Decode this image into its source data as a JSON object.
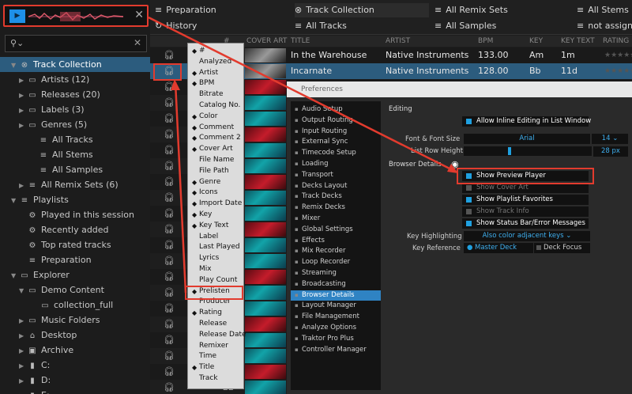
{
  "left": {
    "preview_player": {
      "play_label": "▶",
      "close_label": "✕"
    },
    "search": {
      "placeholder": "",
      "clear_label": "✕"
    },
    "tree": [
      {
        "label": "Track Collection",
        "icon": "collection-icon"
      },
      {
        "label": "Artists (12)",
        "icon": "folder-icon"
      },
      {
        "label": "Releases (20)",
        "icon": "folder-icon"
      },
      {
        "label": "Labels (3)",
        "icon": "folder-icon"
      },
      {
        "label": "Genres (5)",
        "icon": "folder-icon"
      },
      {
        "label": "All Tracks",
        "icon": "list-icon"
      },
      {
        "label": "All Stems",
        "icon": "list-icon"
      },
      {
        "label": "All Samples",
        "icon": "list-icon"
      },
      {
        "label": "All Remix Sets (6)",
        "icon": "list-icon"
      },
      {
        "label": "Playlists",
        "icon": "playlists-icon"
      },
      {
        "label": "Played in this session",
        "icon": "gear-icon"
      },
      {
        "label": "Recently added",
        "icon": "gear-icon"
      },
      {
        "label": "Top rated tracks",
        "icon": "gear-icon"
      },
      {
        "label": "Preparation",
        "icon": "list-icon"
      },
      {
        "label": "Explorer",
        "icon": "monitor-icon"
      },
      {
        "label": "Demo Content",
        "icon": "folder-icon"
      },
      {
        "label": "collection_full",
        "icon": "folder-icon"
      },
      {
        "label": "Music Folders",
        "icon": "folder-icon"
      },
      {
        "label": "Desktop",
        "icon": "home-icon"
      },
      {
        "label": "Archive",
        "icon": "archive-icon"
      },
      {
        "label": "C:",
        "icon": "drive-icon"
      },
      {
        "label": "D:",
        "icon": "drive-icon"
      },
      {
        "label": "E:",
        "icon": "drive-icon"
      }
    ]
  },
  "header": {
    "favorites": [
      {
        "label": "Preparation",
        "icon": "list-icon"
      },
      {
        "label": "History",
        "icon": "history-icon"
      },
      {
        "label": "Track Collection",
        "icon": "collection-icon"
      },
      {
        "label": "All Tracks",
        "icon": "list-icon"
      },
      {
        "label": "All Remix Sets",
        "icon": "list-icon"
      },
      {
        "label": "All Samples",
        "icon": "list-icon"
      },
      {
        "label": "All Stems",
        "icon": "list-icon"
      },
      {
        "label": "not assign",
        "icon": "list-icon"
      }
    ]
  },
  "columns": [
    "#",
    "COVER ART",
    "TITLE",
    "ARTIST",
    "BPM",
    "KEY",
    "KEY TEXT",
    "RATING"
  ],
  "tracks": [
    {
      "title": "In  the Warehouse",
      "artist": "Native Instruments",
      "bpm": "133.00",
      "key": "Am",
      "keytext": "1m",
      "rating": "★★★★★"
    },
    {
      "title": "Incarnate",
      "artist": "Native Instruments",
      "bpm": "128.00",
      "key": "Bb",
      "keytext": "11d",
      "rating": "★★★★★"
    }
  ],
  "last_row_number": "22",
  "column_menu": {
    "items": [
      {
        "label": "#",
        "checked": true
      },
      {
        "label": "Analyzed",
        "checked": false
      },
      {
        "label": "Artist",
        "checked": true
      },
      {
        "label": "BPM",
        "checked": true
      },
      {
        "label": "Bitrate",
        "checked": false
      },
      {
        "label": "Catalog No.",
        "checked": false
      },
      {
        "label": "Color",
        "checked": true
      },
      {
        "label": "Comment",
        "checked": true
      },
      {
        "label": "Comment 2",
        "checked": true
      },
      {
        "label": "Cover Art",
        "checked": true
      },
      {
        "label": "File Name",
        "checked": false
      },
      {
        "label": "File Path",
        "checked": false
      },
      {
        "label": "Genre",
        "checked": true
      },
      {
        "label": "Icons",
        "checked": true
      },
      {
        "label": "Import Date",
        "checked": true
      },
      {
        "label": "Key",
        "checked": true
      },
      {
        "label": "Key Text",
        "checked": true
      },
      {
        "label": "Label",
        "checked": false
      },
      {
        "label": "Last Played",
        "checked": false
      },
      {
        "label": "Lyrics",
        "checked": false
      },
      {
        "label": "Mix",
        "checked": false
      },
      {
        "label": "Play Count",
        "checked": false
      },
      {
        "label": "Prelisten",
        "checked": true
      },
      {
        "label": "Producer",
        "checked": false
      },
      {
        "label": "Rating",
        "checked": true
      },
      {
        "label": "Release",
        "checked": false
      },
      {
        "label": "Release Date",
        "checked": false
      },
      {
        "label": "Remixer",
        "checked": false
      },
      {
        "label": "Time",
        "checked": false
      },
      {
        "label": "Title",
        "checked": true
      },
      {
        "label": "Track",
        "checked": false
      }
    ]
  },
  "preferences": {
    "title": "Preferences",
    "sidebar": [
      "Audio Setup",
      "Output Routing",
      "Input Routing",
      "External Sync",
      "Timecode Setup",
      "Loading",
      "Transport",
      "Decks Layout",
      "Track Decks",
      "Remix Decks",
      "Mixer",
      "Global Settings",
      "Effects",
      "Mix Recorder",
      "Loop Recorder",
      "Streaming",
      "Broadcasting",
      "Browser Details",
      "Layout Manager",
      "File Management",
      "Analyze Options",
      "Traktor Pro Plus",
      "Controller Manager"
    ],
    "active_index": 17,
    "editing": {
      "section": "Editing",
      "inline_edit": "Allow Inline Editing in List Window",
      "font_label": "Font & Font Size",
      "font_value": "Arial",
      "font_size": "14",
      "row_height_label": "List Row Height",
      "row_height_value": "28 px",
      "row_height_fraction": 0.35
    },
    "browser_details": {
      "section": "Browser Details",
      "options": [
        {
          "label": "Show Preview Player",
          "on": true
        },
        {
          "label": "Show Cover Art",
          "on": false
        },
        {
          "label": "Show Playlist Favorites",
          "on": true
        },
        {
          "label": "Show Track Info",
          "on": false
        },
        {
          "label": "Show Status Bar/Error Messages",
          "on": true
        }
      ],
      "key_highlight_label": "Key Highlighting",
      "key_highlight_value": "Also color adjacent keys",
      "key_ref_label": "Key Reference",
      "key_ref_master": "Master Deck",
      "key_ref_focus": "Deck Focus"
    }
  },
  "colors": {
    "accent": "#1fa0e0",
    "selection": "#2c5c7e",
    "highlight_box": "#e23b2e"
  }
}
